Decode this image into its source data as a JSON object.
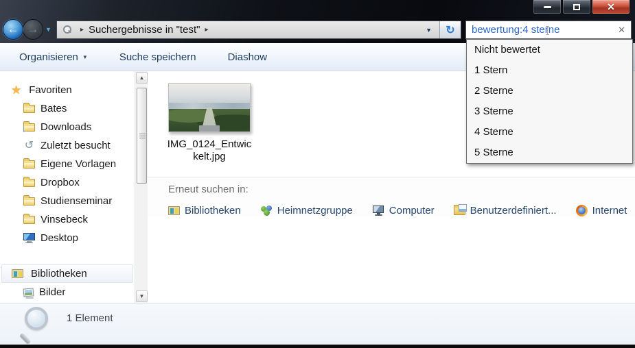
{
  "titlebar": {
    "breadcrumb": {
      "location": "Suchergebnisse in \"test\""
    }
  },
  "search": {
    "value": "bewertung:4 sterne",
    "dropdown": {
      "items": [
        "Nicht bewertet",
        "1 Stern",
        "2 Sterne",
        "3 Sterne",
        "4 Sterne",
        "5 Sterne"
      ]
    }
  },
  "toolbar": {
    "organize": "Organisieren",
    "save_search": "Suche speichern",
    "slideshow": "Diashow"
  },
  "sidebar": {
    "favorites": {
      "label": "Favoriten",
      "items": [
        "Bates",
        "Downloads",
        "Zuletzt besucht",
        "Eigene Vorlagen",
        "Dropbox",
        "Studienseminar",
        "Vinsebeck",
        "Desktop"
      ]
    },
    "libraries": {
      "label": "Bibliotheken",
      "items": [
        "Bilder"
      ]
    }
  },
  "content": {
    "file": {
      "name_lines": [
        "IMG_0124_Entwic",
        "kelt.jpg"
      ]
    },
    "search_again": {
      "label": "Erneut suchen in:",
      "locations": [
        "Bibliotheken",
        "Heimnetzgruppe",
        "Computer",
        "Benutzerdefiniert...",
        "Internet"
      ]
    }
  },
  "statusbar": {
    "count": "1 Element"
  },
  "icons": {
    "back": "←",
    "forward": "→",
    "crumb": "▸",
    "dropdown": "▼",
    "caret": "▼",
    "refresh": "↻",
    "clear": "✕",
    "close": "✕",
    "star": "★",
    "download": "↓",
    "recent": "↺",
    "scroll_up": "▲",
    "scroll_down": "▼"
  },
  "colors": {
    "search_text": "#2d66c4",
    "toolbar_text": "#1f3c5e",
    "link_text": "#26456b",
    "close_button_red": "#c14b33"
  }
}
